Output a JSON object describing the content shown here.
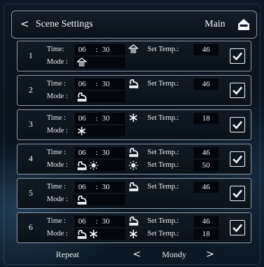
{
  "header": {
    "back_glyph": "<",
    "title": "Scene Settings",
    "main_label": "Main",
    "home_icon": "house-icon"
  },
  "labels": {
    "time": "Time:",
    "time_alt": "Time :",
    "mode": "Mode :",
    "set_temp_a": "Set Temp.:",
    "set_temp_b": "Set Temp.:",
    "colon": ":"
  },
  "rows": [
    {
      "num": "1",
      "hour": "06",
      "minute": "30",
      "mode_icons": [
        "heat-icon"
      ],
      "temps": [
        "46"
      ],
      "checked": true
    },
    {
      "num": "2",
      "hour": "06",
      "minute": "30",
      "mode_icons": [
        "hot-water-icon"
      ],
      "temps": [
        "46"
      ],
      "checked": true
    },
    {
      "num": "3",
      "hour": "06",
      "minute": "30",
      "mode_icons": [
        "cooling-snowflake-icon"
      ],
      "temps": [
        "18"
      ],
      "checked": true
    },
    {
      "num": "4",
      "hour": "06",
      "minute": "30",
      "mode_icons": [
        "hot-water-icon",
        "sun-heating-icon"
      ],
      "temps": [
        "46",
        "50"
      ],
      "checked": true
    },
    {
      "num": "5",
      "hour": "06",
      "minute": "30",
      "mode_icons": [
        "hot-water-icon"
      ],
      "temps": [
        "46"
      ],
      "checked": true
    },
    {
      "num": "6",
      "hour": "06",
      "minute": "30",
      "mode_icons": [
        "hot-water-icon",
        "cooling-snowflake-icon"
      ],
      "temps": [
        "46",
        "18"
      ],
      "checked": true
    }
  ],
  "footer": {
    "repeat_label": "Repeat",
    "day": "Mondy",
    "prev_glyph": "<",
    "next_glyph": ">"
  }
}
